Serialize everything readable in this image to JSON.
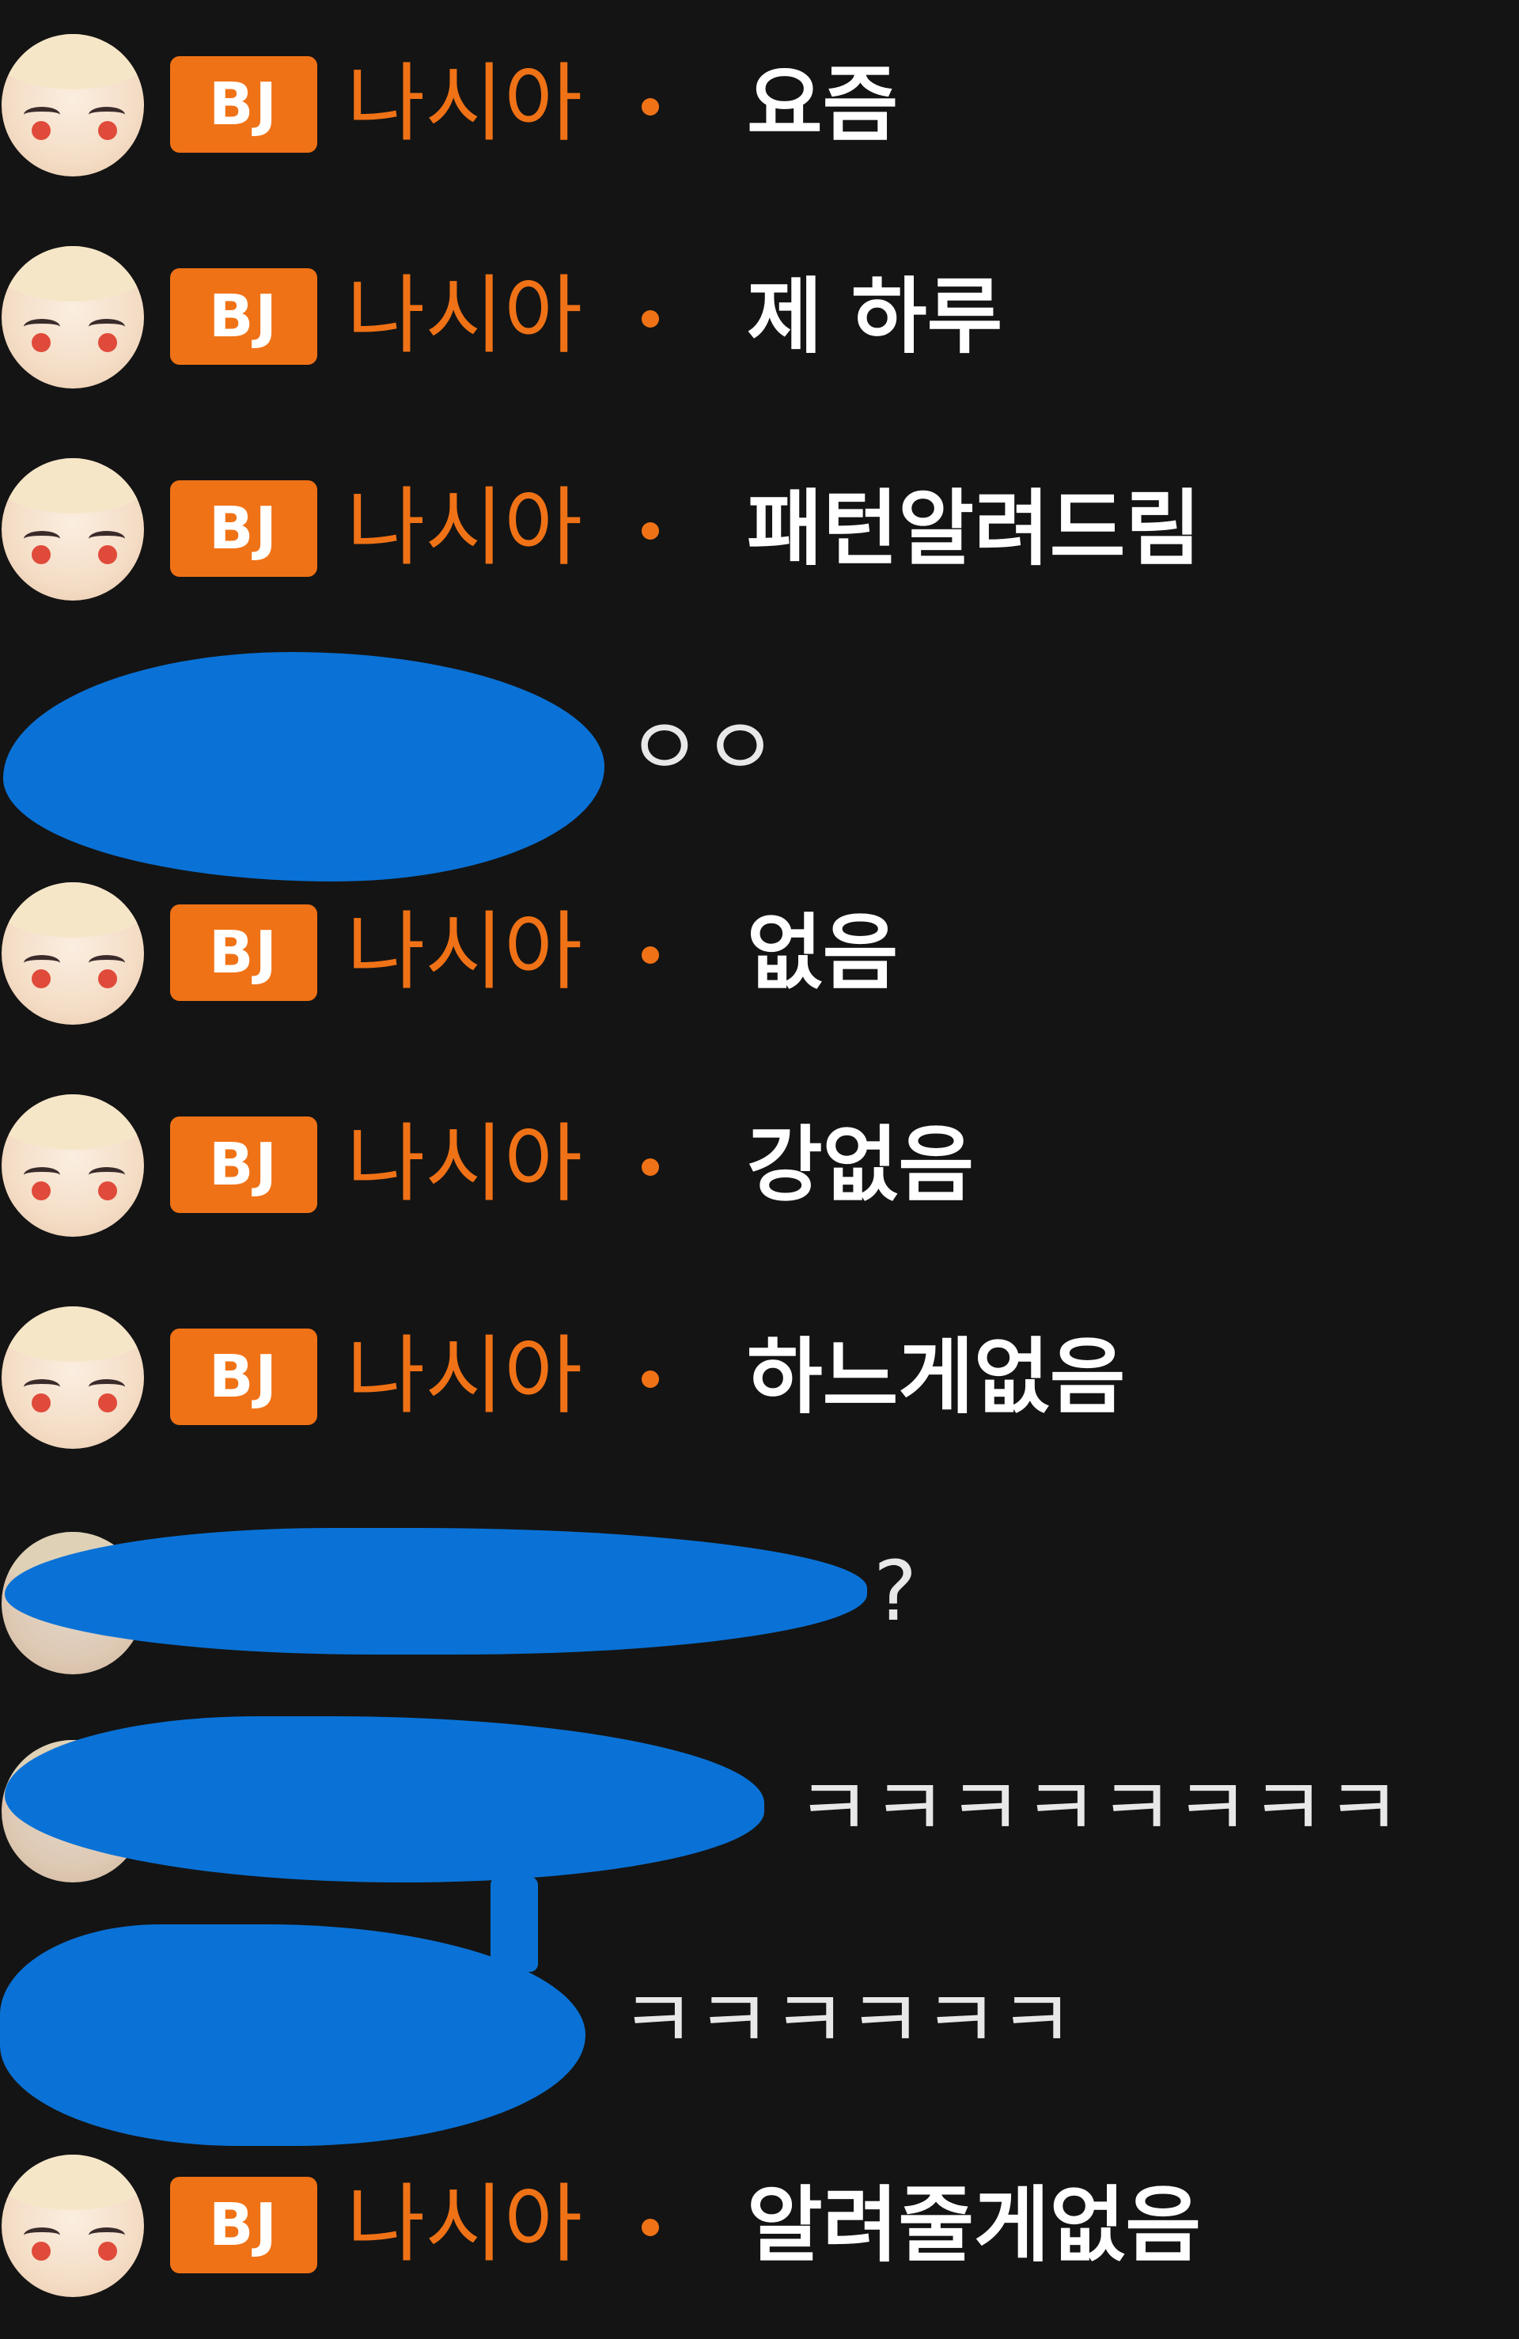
{
  "streamer": {
    "badge": "BJ",
    "nickname": "나시아"
  },
  "colors": {
    "background": "#141414",
    "accent": "#f07216",
    "redaction": "#0a72d6",
    "text": "#ffffff"
  },
  "messages": [
    {
      "type": "streamer",
      "text": "요즘"
    },
    {
      "type": "streamer",
      "text": "제 하루"
    },
    {
      "type": "streamer",
      "text": "패턴알려드림"
    },
    {
      "type": "viewer_redacted",
      "text": "ㅇㅇ"
    },
    {
      "type": "streamer",
      "text": "없음"
    },
    {
      "type": "streamer",
      "text": "강없음"
    },
    {
      "type": "streamer",
      "text": "하느게없음"
    },
    {
      "type": "viewer_redacted",
      "text": "?"
    },
    {
      "type": "viewer_redacted",
      "text": "ㅋㅋㅋㅋㅋㅋㅋㅋ"
    },
    {
      "type": "viewer_redacted",
      "text": "ㅋㅋㅋㅋㅋㅋ"
    },
    {
      "type": "streamer",
      "text": "알려줄게없음"
    }
  ]
}
